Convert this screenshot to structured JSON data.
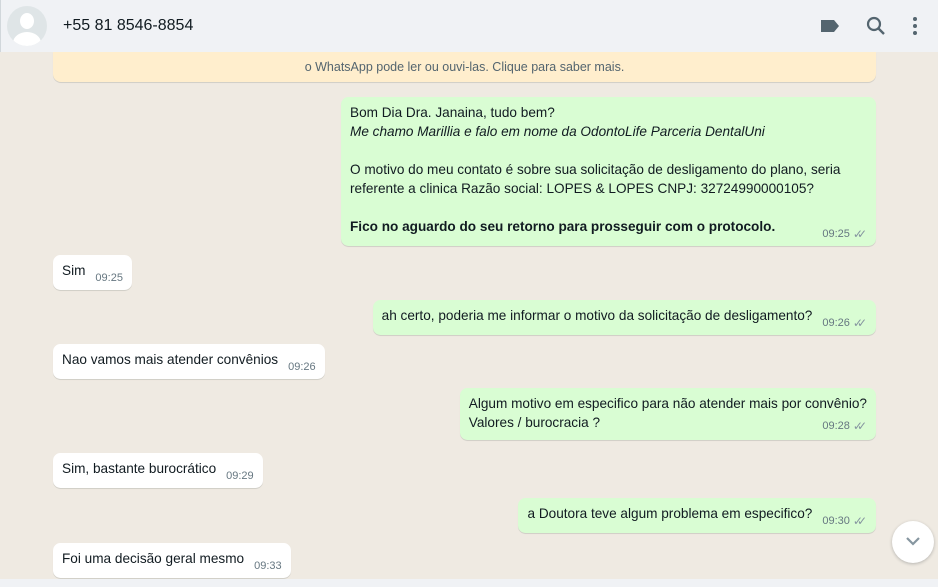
{
  "header": {
    "contact": "+55 81 8546-8854",
    "icons": [
      "label-icon",
      "search-icon",
      "menu-icon"
    ]
  },
  "banner": {
    "text": "o WhatsApp pode ler ou ouvi-las. Clique para saber mais."
  },
  "messages": [
    {
      "dir": "out",
      "line1": "Bom Dia Dra. Janaina, tudo bem?",
      "line2": "Me chamo Marillia e falo em nome da OdontoLife Parceria DentalUni",
      "line3": "O motivo do meu contato é sobre sua solicitação de desligamento do plano, seria referente a clinica Razão social: LOPES & LOPES CNPJ: 32724990000105?",
      "line4": "Fico no aguardo do seu retorno para prosseguir com o protocolo.",
      "time": "09:25"
    },
    {
      "dir": "in",
      "text": "Sim",
      "time": "09:25"
    },
    {
      "dir": "out",
      "text": "ah certo, poderia me informar o motivo da solicitação de desligamento?",
      "time": "09:26"
    },
    {
      "dir": "in",
      "text": "Nao vamos mais atender convênios",
      "time": "09:26"
    },
    {
      "dir": "out",
      "text": "Algum motivo em especifico para não atender mais por convênio?",
      "text2": "Valores / burocracia ?",
      "time": "09:28"
    },
    {
      "dir": "in",
      "text": "Sim, bastante burocrático",
      "time": "09:29"
    },
    {
      "dir": "out",
      "text": "a Doutora teve algum problema em especifico?",
      "time": "09:30"
    },
    {
      "dir": "in",
      "text": "Foi uma decisão geral mesmo",
      "time": "09:33"
    }
  ]
}
